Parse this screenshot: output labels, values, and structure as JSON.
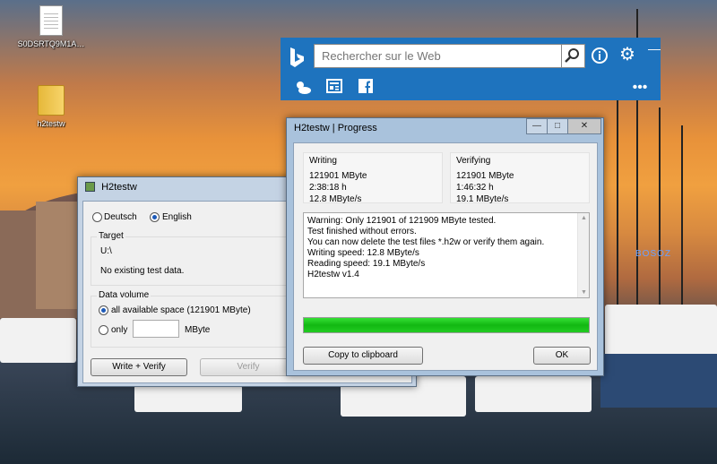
{
  "desktop": {
    "icons": [
      {
        "label": "S0DSRTQ9M1A…",
        "icon": "text-file-icon"
      },
      {
        "label": "h2testw",
        "icon": "folder-icon"
      }
    ],
    "neon_sign": "BOSOZ"
  },
  "bing": {
    "placeholder": "Rechercher sur le Web",
    "icons": [
      "bing-logo-icon",
      "search-icon",
      "info-icon",
      "gear-icon",
      "close-icon",
      "weather-icon",
      "news-icon",
      "facebook-icon",
      "more-icon"
    ],
    "accent": "#1e73be"
  },
  "h2testw": {
    "title": "H2testw",
    "lang_deutsch": "Deutsch",
    "lang_english": "English",
    "target_label": "Target",
    "target_path": "U:\\",
    "target_status": "No existing test data.",
    "volume_label": "Data volume",
    "all_space": "all available space (121901 MByte)",
    "only": "only",
    "mbyte": "MByte",
    "only_value": "",
    "write_verify": "Write + Verify",
    "verify": "Verify"
  },
  "progress": {
    "title": "H2testw | Progress",
    "writing": {
      "label": "Writing",
      "size": "121901 MByte",
      "time": "2:38:18 h",
      "speed": "12.8 MByte/s"
    },
    "verifying": {
      "label": "Verifying",
      "size": "121901 MByte",
      "time": "1:46:32 h",
      "speed": "19.1 MByte/s"
    },
    "log": [
      "Warning: Only 121901 of 121909 MByte tested.",
      "Test finished without errors.",
      "You can now delete the test files *.h2w or verify them again.",
      "Writing speed: 12.8 MByte/s",
      "Reading speed: 19.1 MByte/s",
      "H2testw v1.4"
    ],
    "progress_fraction": 1.0,
    "progress_color": "#14c814",
    "copy_btn": "Copy to clipboard",
    "ok_btn": "OK",
    "win_controls": {
      "minimize": "—",
      "maximize": "□",
      "close": "✕"
    }
  }
}
